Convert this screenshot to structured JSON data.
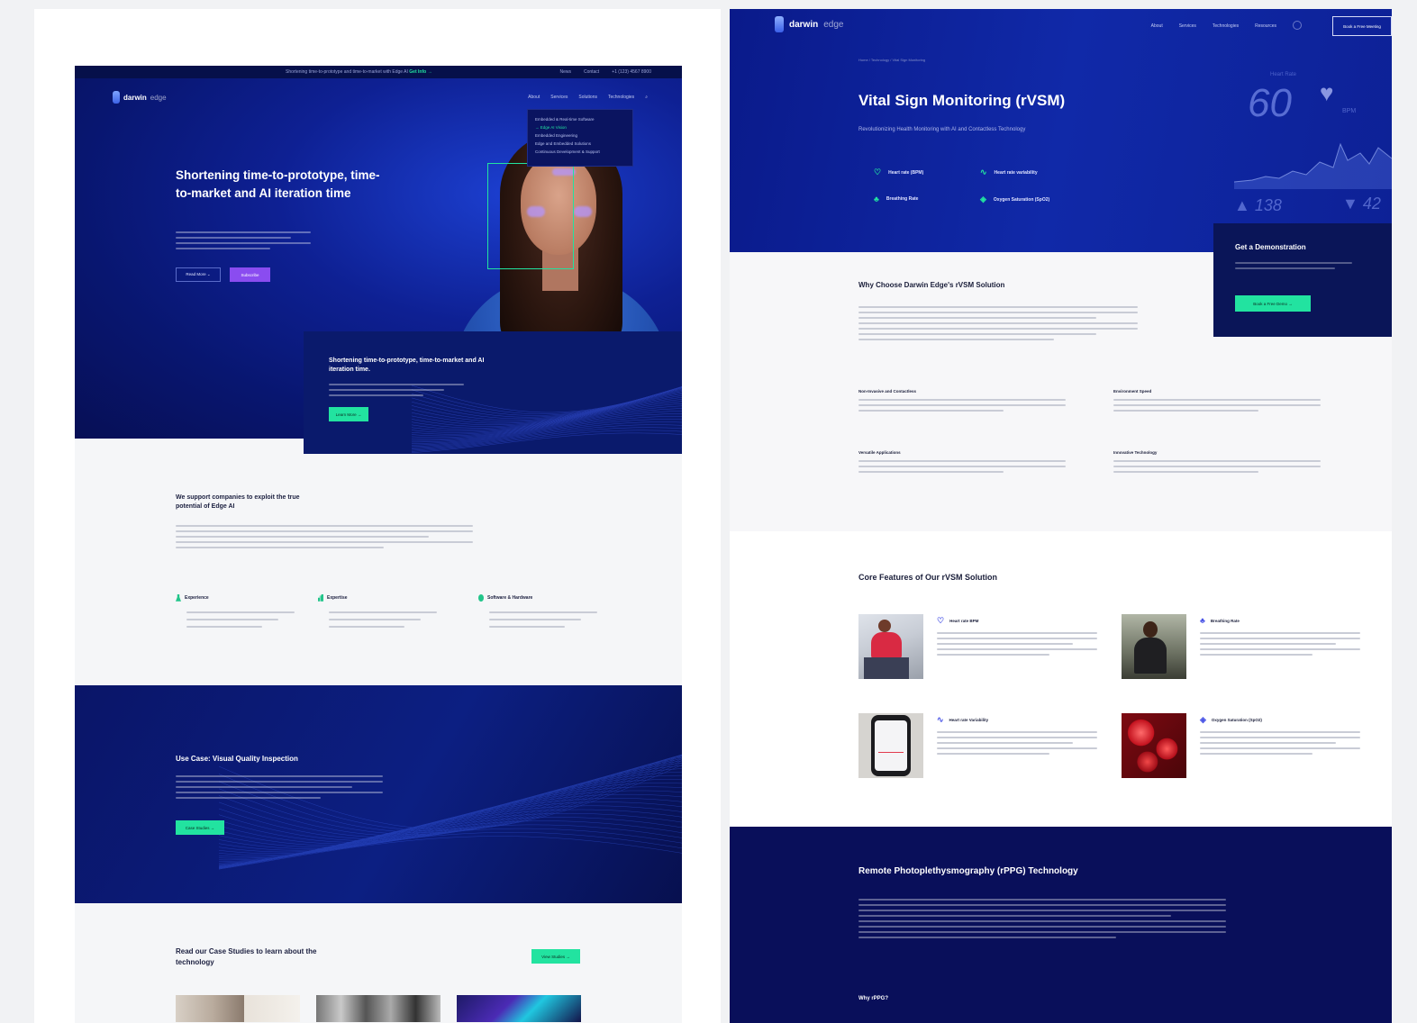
{
  "left_page": {
    "topbar": {
      "promo": "Shortening time-to-prototype and time-to-market with Edge AI ",
      "promo_link": "Get Info →",
      "links": [
        "News",
        "Contact",
        "+1 (123) 4567 8900"
      ]
    },
    "logo": {
      "brand": "darwin",
      "suffix": "edge"
    },
    "nav": [
      "About",
      "Services",
      "Solutions",
      "Technologies",
      "⌕"
    ],
    "dropdown": [
      "Embedded & Real-time Software",
      "→ Edge AI Vision",
      "Embedded Engineering",
      "Edge and Embedded Solutions",
      "Continuous Development & Support"
    ],
    "hero": {
      "title": "Shortening time-to-prototype, time-to-market and AI iteration time",
      "btn_outline": "Read More ⌄",
      "btn_primary": "Subscribe"
    },
    "overlay": {
      "title": "Shortening time-to-prototype, time-to-market and AI iteration time.",
      "btn": "Learn More →"
    },
    "support": {
      "title": "We support companies to exploit the true potential of Edge AI"
    },
    "features": [
      {
        "title": "Experience",
        "icon": "flask-icon",
        "color": "#22c58a"
      },
      {
        "title": "Expertise",
        "icon": "chart-icon",
        "color": "#22c58a"
      },
      {
        "title": "Software & Hardware",
        "icon": "chip-icon",
        "color": "#22c58a"
      }
    ],
    "usecase": {
      "title": "Use Case: Visual Quality Inspection",
      "btn": "Case Studies →"
    },
    "cases": {
      "title": "Read our Case Studies to learn about the technology",
      "btn": "View Studies →"
    }
  },
  "right_page": {
    "logo": {
      "brand": "darwin",
      "suffix": "edge"
    },
    "nav": [
      "About",
      "Services",
      "Technologies",
      "Resources"
    ],
    "cta": "Book a Free Meeting",
    "breadcrumb": "Home  /  Technology  /  Vital Sign Monitoring",
    "title": "Vital Sign Monitoring (rVSM)",
    "subtitle": "Revolutionizing Health Monitoring with AI and Contactless Technology",
    "vitals": [
      {
        "label": "Heart rate (BPM)",
        "icon": "heart-icon"
      },
      {
        "label": "Heart rate variability",
        "icon": "pulse-icon"
      },
      {
        "label": "Breathing Rate",
        "icon": "lungs-icon"
      },
      {
        "label": "Oxygen Saturation (SpO2)",
        "icon": "drop-icon"
      }
    ],
    "graphic": {
      "label": "Heart Rate",
      "bpm": "60",
      "unit": "BPM",
      "stat_left": "▲ 138",
      "stat_right": "▼ 42"
    },
    "demo": {
      "title": "Get a Demonstration",
      "btn": "Book a Free Demo →"
    },
    "why": {
      "title": "Why Choose Darwin Edge's rVSM Solution"
    },
    "benefits": [
      "Non-Invasive and Contactless",
      "Environment Speed",
      "Versatile Applications",
      "Innovative Technology"
    ],
    "core": {
      "title": "Core Features of Our rVSM Solution",
      "items": [
        {
          "title": "Heart rate BPM",
          "icon": "heart-icon"
        },
        {
          "title": "Breathing Rate",
          "icon": "lungs-icon"
        },
        {
          "title": "Heart rate Variability",
          "icon": "pulse-icon"
        },
        {
          "title": "Oxygen Saturation (SpO2)",
          "icon": "drop-icon"
        }
      ]
    },
    "rppg": {
      "title": "Remote Photoplethysmography (rPPG) Technology",
      "why_title": "Why rPPG?"
    }
  },
  "colors": {
    "navy": "#081670",
    "blue": "#1029a8",
    "accent_green": "#22e3a0",
    "accent_purple": "#8a4cf0",
    "deep_navy": "#090f5a"
  }
}
